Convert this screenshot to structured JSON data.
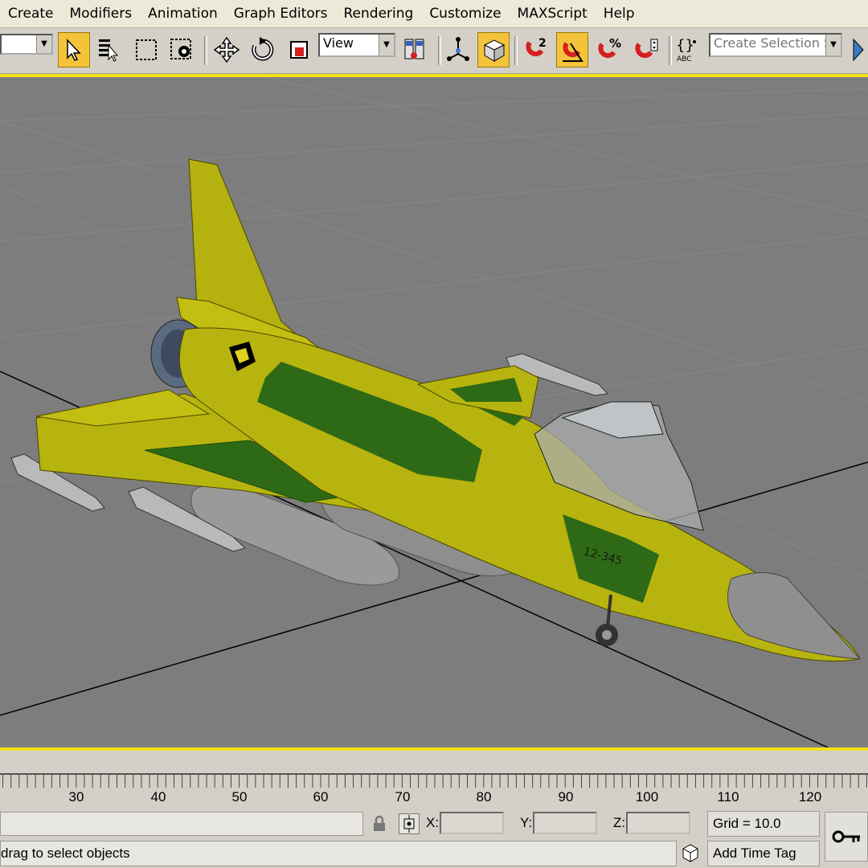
{
  "menubar": {
    "items": [
      "Create",
      "Modifiers",
      "Animation",
      "Graph Editors",
      "Rendering",
      "Customize",
      "MAXScript",
      "Help"
    ]
  },
  "toolbar": {
    "reference_coord_value": "View",
    "selection_set_placeholder": "Create Selection Set",
    "icons": [
      "select-object",
      "select-by-name",
      "rectangular-selection-region",
      "window-crossing",
      "select-and-move",
      "select-and-rotate",
      "select-and-scale",
      "reference-coordinate-system",
      "use-pivot-point-center",
      "select-and-manipulate",
      "keyboard-shortcut-override",
      "snaps-toggle",
      "angle-snap-toggle",
      "percent-snap-toggle",
      "spinner-snap-toggle",
      "edit-named-selection-sets"
    ],
    "snap_superscript": "2",
    "percent_symbol": "%",
    "named_sel_abc": "ABC",
    "colors": {
      "active_button": "#f3c43a",
      "viewport_border": "#f2e11a",
      "viewport_bg": "#7d7d7d"
    }
  },
  "timeline": {
    "tick_labels": [
      "30",
      "40",
      "50",
      "60",
      "70",
      "80",
      "90",
      "100",
      "110",
      "120"
    ]
  },
  "status": {
    "x_label": "X:",
    "y_label": "Y:",
    "z_label": "Z:",
    "x_value": "",
    "y_value": "",
    "z_value": "",
    "grid_text": "Grid = 10.0",
    "prompt_text": "drag to select objects",
    "add_time_tag": "Add Time Tag",
    "icons": [
      "lock-icon",
      "absolute-mode-icon",
      "key-icon",
      "time-tag-icon"
    ]
  },
  "viewport": {
    "aircraft_tail_number": "12-345",
    "colors": {
      "aircraft_yellow": "#b8b40f",
      "aircraft_green": "#2e6a15",
      "tank_gray": "#9a9a9a"
    }
  }
}
